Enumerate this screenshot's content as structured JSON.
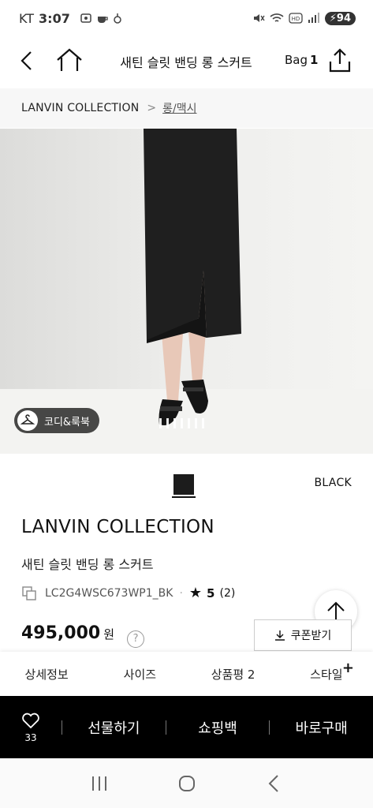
{
  "status_bar": {
    "carrier": "KT",
    "time": "3:07",
    "battery": "94",
    "icons": [
      "screenshot-icon",
      "coffee-icon",
      "alarm-icon",
      "mute-icon",
      "wifi-icon",
      "hd-icon",
      "signal-icon",
      "battery-icon"
    ]
  },
  "header": {
    "title": "새틴 슬릿 밴딩 롱 스커트",
    "bag_label": "Bag",
    "bag_count": "1"
  },
  "breadcrumb": {
    "brand": "LANVIN COLLECTION",
    "separator": ">",
    "category": "롱/맥시"
  },
  "image": {
    "coordi_label": "코디&룩북",
    "pager_count": 7
  },
  "product": {
    "color_name": "BLACK",
    "swatch_color": "#1c1c1c",
    "brand": "LANVIN COLLECTION",
    "name": "새틴 슬릿 밴딩 롱 스커트",
    "sku": "LC2G4WSC673WP1_BK",
    "sku_dot": "·",
    "rating_star": "★",
    "rating": "5",
    "review_count": "(2)",
    "price": "495,000",
    "price_unit": "원",
    "help_symbol": "?",
    "coupon_label": "쿠폰받기"
  },
  "tabs": [
    {
      "label": "상세정보"
    },
    {
      "label": "사이즈"
    },
    {
      "label": "상품평 2"
    },
    {
      "label": "스타일"
    }
  ],
  "tab_plus": "+",
  "actions": {
    "like_count": "33",
    "gift_label": "선물하기",
    "bag_label": "쇼핑백",
    "buy_label": "바로구매"
  }
}
